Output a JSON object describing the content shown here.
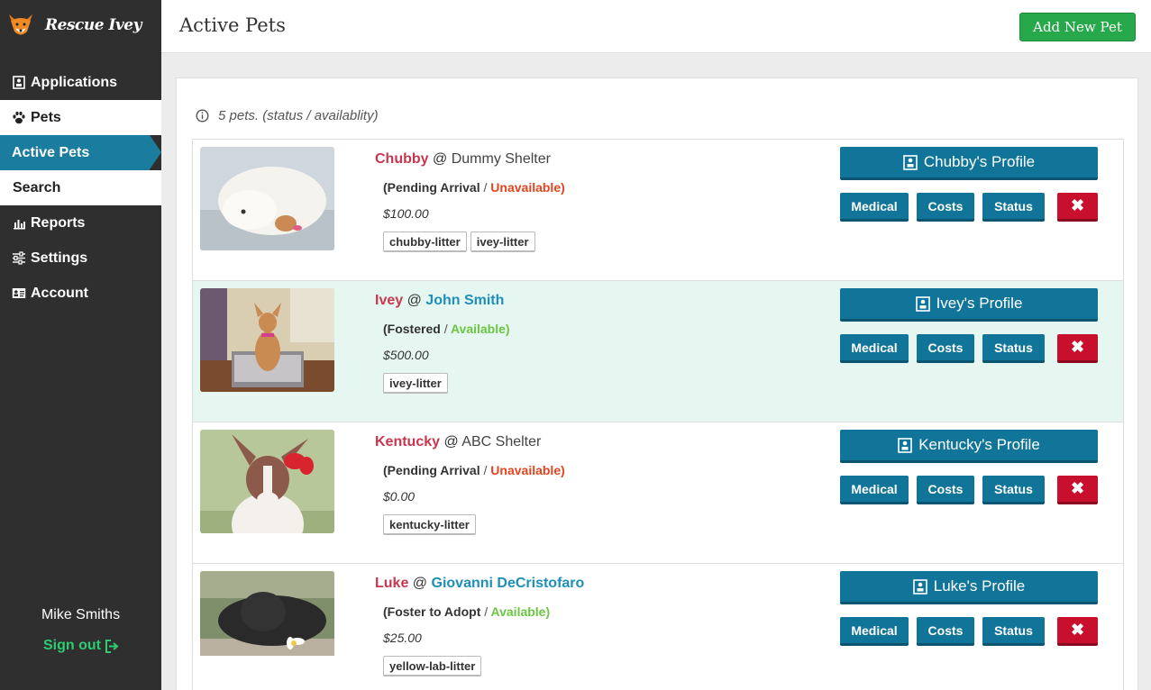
{
  "brand": {
    "name": "Rescue Ivey",
    "logo_icon": "fox-logo-icon"
  },
  "sidebar": {
    "items": [
      {
        "label": "Applications",
        "icon": "document-icon"
      },
      {
        "label": "Pets",
        "icon": "paw-icon"
      },
      {
        "label": "Active Pets",
        "icon": ""
      },
      {
        "label": "Search",
        "icon": ""
      },
      {
        "label": "Reports",
        "icon": "bar-chart-icon"
      },
      {
        "label": "Settings",
        "icon": "sliders-icon"
      },
      {
        "label": "Account",
        "icon": "id-card-icon"
      }
    ],
    "user_name": "Mike Smiths",
    "signout_label": "Sign out"
  },
  "header": {
    "title": "Active Pets",
    "add_label": "Add New Pet"
  },
  "main": {
    "info_text": "5 pets. (status / availablity)"
  },
  "colors": {
    "accent": "#11759a",
    "brand_green": "#27a84a",
    "danger": "#c8102e",
    "pet_name": "#c9374f"
  },
  "pets": [
    {
      "name": "Chubby",
      "at": "@",
      "location": "Dummy Shelter",
      "location_link": false,
      "status": "(Pending Arrival",
      "slash": "/",
      "availability": "Unavailable)",
      "cost": "$100.00",
      "tags": [
        "chubby-litter",
        "ivey-litter"
      ],
      "profile_label": "Chubby's Profile"
    },
    {
      "name": "Ivey",
      "at": "@",
      "location": "John Smith",
      "location_link": true,
      "status": "(Fostered",
      "slash": "/",
      "availability": "Available)",
      "cost": "$500.00",
      "tags": [
        "ivey-litter"
      ],
      "profile_label": "Ivey's Profile"
    },
    {
      "name": "Kentucky",
      "at": "@",
      "location": "ABC Shelter",
      "location_link": false,
      "status": "(Pending Arrival",
      "slash": "/",
      "availability": "Unavailable)",
      "cost": "$0.00",
      "tags": [
        "kentucky-litter"
      ],
      "profile_label": "Kentucky's Profile"
    },
    {
      "name": "Luke",
      "at": "@",
      "location": "Giovanni DeCristofaro",
      "location_link": true,
      "status": "(Foster to Adopt",
      "slash": "/",
      "availability": "Available)",
      "cost": "$25.00",
      "tags": [
        "yellow-lab-litter"
      ],
      "profile_label": "Luke's Profile"
    }
  ],
  "actions": {
    "medical": "Medical",
    "costs": "Costs",
    "status": "Status",
    "delete": "✖"
  }
}
